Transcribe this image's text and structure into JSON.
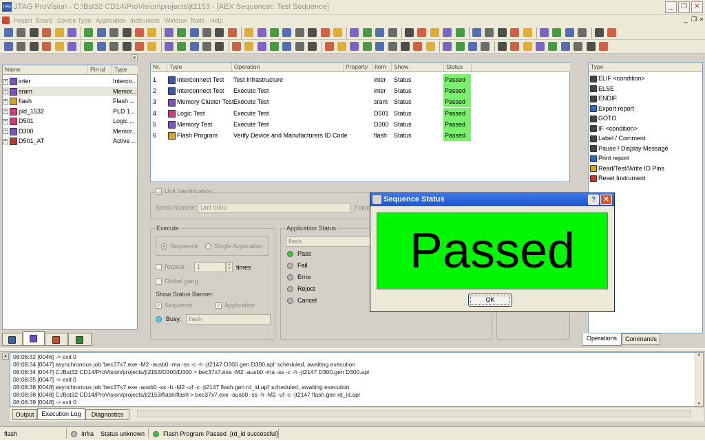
{
  "window": {
    "title": "JTAG ProVision - C:\\Bst32 CD14\\ProVision\\projects\\jt2153 - [AEX Sequencer: Test Sequence]",
    "app_icon_text": "JTAG"
  },
  "menu": [
    "Project",
    "Board",
    "Device Type",
    "Application",
    "Instrument",
    "Window",
    "Tools",
    "Help"
  ],
  "tree": {
    "headers": {
      "name": "Name",
      "pin_id": "Pin id",
      "type": "Type"
    },
    "items": [
      {
        "name": "inter",
        "type": "Interco...",
        "color": "#7a52c7"
      },
      {
        "name": "sram",
        "type": "Memor...",
        "color": "#7a52c7",
        "selected": true
      },
      {
        "name": "flash",
        "type": "Flash ...",
        "color": "#d9a520"
      },
      {
        "name": "pld_1532",
        "type": "PLD 1...",
        "color": "#d43a8a"
      },
      {
        "name": "D501",
        "type": "Logic ...",
        "color": "#d43a8a"
      },
      {
        "name": "D300",
        "type": "Memor...",
        "color": "#7a52c7"
      },
      {
        "name": "D501_AT",
        "type": "Active ...",
        "color": "#c0392b"
      }
    ]
  },
  "sequence": {
    "headers": {
      "nr": "Nr.",
      "type": "Type",
      "operation": "Operation",
      "property": "Property",
      "item": "Item",
      "show": "Show",
      "status": "Status"
    },
    "rows": [
      {
        "nr": "1",
        "type": "Interconnect Test",
        "operation": "Test Infrastructure",
        "item": "inter",
        "show": "Status",
        "status": "Passed"
      },
      {
        "nr": "2",
        "type": "Interconnect Test",
        "operation": "Execute Test",
        "item": "inter",
        "show": "Status",
        "status": "Passed"
      },
      {
        "nr": "3",
        "type": "Memory Cluster Test",
        "operation": "Execute Test",
        "item": "sram",
        "show": "Status",
        "status": "Passed"
      },
      {
        "nr": "4",
        "type": "Logic Test",
        "operation": "Execute Test",
        "item": "D501",
        "show": "Status",
        "status": "Passed"
      },
      {
        "nr": "5",
        "type": "Memory Test",
        "operation": "Execute Test",
        "item": "D300",
        "show": "Status",
        "status": "Passed"
      },
      {
        "nr": "6",
        "type": "Flash Program",
        "operation": "Verify Device and Manufacturers ID Code",
        "item": "flash",
        "show": "Status",
        "status": "Passed"
      }
    ]
  },
  "unit": {
    "label": "Unit Identification",
    "serial_label": "Serial Number:",
    "serial_value": "Unit 0000",
    "folder_label": "Folde"
  },
  "execute": {
    "label": "Execute",
    "sequence": "Sequence",
    "single": "Single Application",
    "repeat": "Repeat",
    "repeat_value": "1",
    "times": "times",
    "global_gang": "Global gang",
    "show_banner": "Show Status Banner:",
    "banner_sequence": "Sequence",
    "banner_application": "Application",
    "busy": "Busy:",
    "busy_value": "flash"
  },
  "app_status": {
    "label": "Application Status",
    "value": "flash",
    "states": [
      {
        "label": "Pass",
        "color": "#33cc33"
      },
      {
        "label": "Fail",
        "color": "#b5b5b5"
      },
      {
        "label": "Error",
        "color": "#b5b5b5"
      },
      {
        "label": "Reject",
        "color": "#b5b5b5"
      },
      {
        "label": "Cancel",
        "color": "#b5b5b5"
      }
    ]
  },
  "operations": {
    "header": "Type",
    "items": [
      "ELIF <condition>",
      "ELSE",
      "ENDIF",
      "Export report",
      "GOTO",
      "IF <condition>",
      "Label / Comment",
      "Pause / Display Message",
      "Print report",
      "Read/Test/Write IO Pins",
      "Reset Instrument"
    ],
    "tabs": [
      "Operations",
      "Commands"
    ]
  },
  "dialog": {
    "title": "Sequence Status",
    "banner": "Passed",
    "ok": "OK",
    "help": "?",
    "close": "✕",
    "banner_color": "#00f500"
  },
  "log": {
    "lines": [
      "08:08:32 [0046] -> exit 0",
      "08:08:34 [0047] asynchronous job 'bec37x7.exe -M2 -ausb0 -ma -ss -c -h -jt2147 D300.gen D300.apl' scheduled, awaiting execution",
      "08:08:34 [0047] C:/Bst32 CD14/ProVision/projects/jt2153/D300/D300 > bec37x7.exe -M2 -ausb0 -ma -ss -c -h -jt2147 D300.gen D300.apl",
      "08:08:35 [0047] -> exit 0",
      "08:08:38 [0048] asynchronous job 'bec37x7.exe -ausb0 -ss -h -M2 -uf -c -jt2147 flash.gen rd_id.apl' scheduled, awaiting execution",
      "08:08:38 [0048] C:/Bst32 CD14/ProVision/projects/jt2153/flash/flash > bec37x7.exe -ausb0 -ss -h -M2 -uf -c -jt2147 flash.gen rd_id.apl",
      "08:08:39 [0048] -> exit 0"
    ],
    "tabs": [
      "Output",
      "Execution Log",
      "Diagnostics"
    ]
  },
  "status": {
    "left": "flash",
    "infra": "Infra",
    "infra_status": "Status unknown",
    "job": "Flash Program",
    "job_status": "Passed",
    "job_detail": "[rd_id successful]"
  }
}
